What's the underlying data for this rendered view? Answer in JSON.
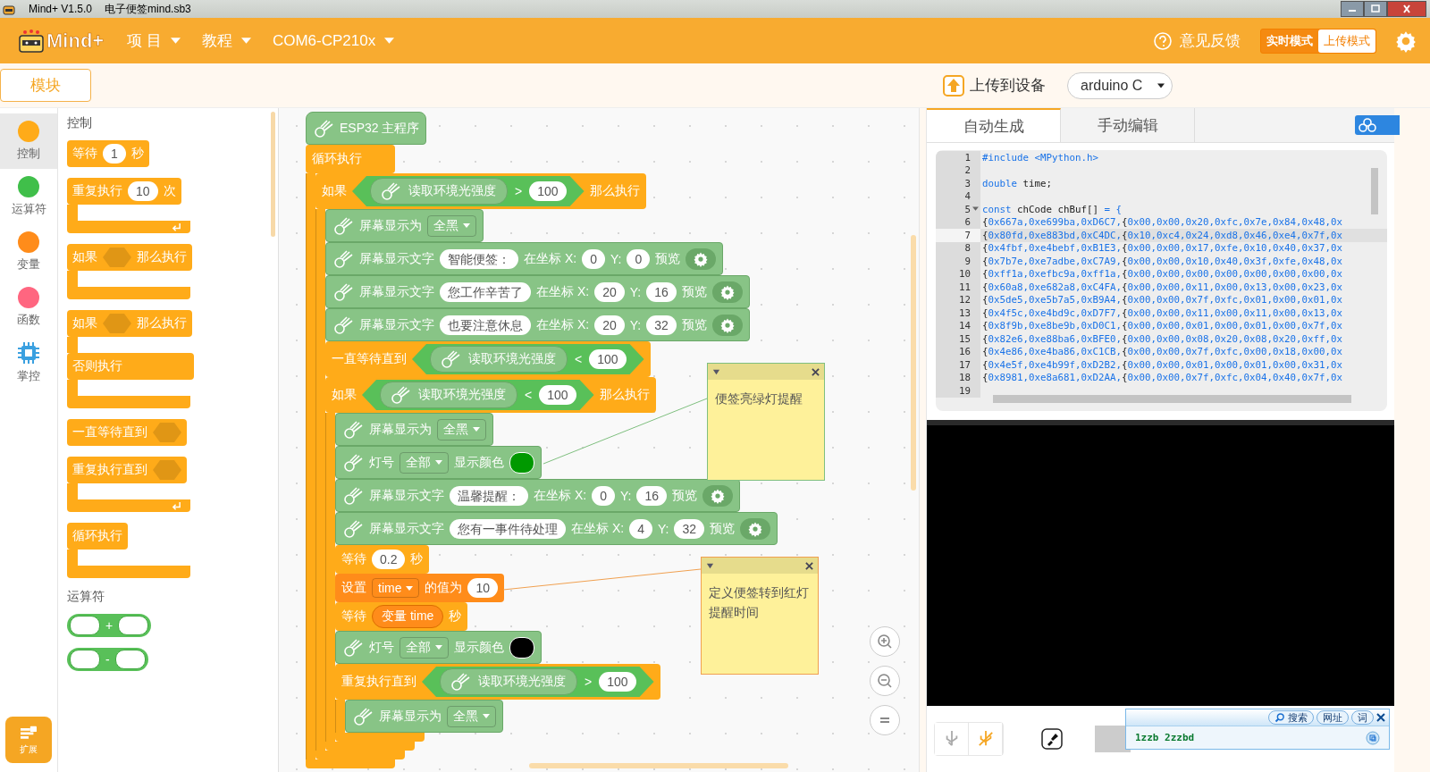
{
  "window": {
    "title": "Mind+ V1.5.0",
    "file": "电子便签mind.sb3"
  },
  "header": {
    "logo": "Mind+",
    "menus": [
      {
        "label": "项 目"
      },
      {
        "label": "教程"
      },
      {
        "label": "COM6-CP210x"
      }
    ],
    "feedback": "意见反馈",
    "modes": [
      {
        "label": "实时模式",
        "selected": false
      },
      {
        "label": "上传模式",
        "selected": true
      }
    ]
  },
  "toolbar": {
    "blocks_tab": "模块",
    "upload_button": "上传到设备",
    "board_select": "arduino C"
  },
  "categories": [
    {
      "label": "控制",
      "kind": "dot",
      "color": "#ffab19",
      "selected": true
    },
    {
      "label": "运算符",
      "kind": "dot",
      "color": "#40bf4a",
      "selected": false
    },
    {
      "label": "变量",
      "kind": "dot",
      "color": "#ff8c1a",
      "selected": false
    },
    {
      "label": "函数",
      "kind": "dot",
      "color": "#ff6680",
      "selected": false
    },
    {
      "label": "掌控",
      "kind": "chip",
      "color": "#3aa0e0",
      "selected": false
    }
  ],
  "extensions_button": "扩展",
  "palette": [
    {
      "title": "控制",
      "blocks": [
        {
          "kind": "stack",
          "color": "#ffab19",
          "parts": [
            {
              "kind": "text",
              "text": "等待"
            },
            {
              "kind": "field",
              "text": "1"
            },
            {
              "kind": "text",
              "text": "秒"
            }
          ]
        },
        {
          "kind": "loop",
          "color": "#ffab19",
          "parts": [
            {
              "kind": "text",
              "text": "重复执行"
            },
            {
              "kind": "field",
              "text": "10"
            },
            {
              "kind": "text",
              "text": "次"
            }
          ]
        },
        {
          "kind": "c",
          "color": "#ffab19",
          "parts": [
            {
              "kind": "text",
              "text": "如果"
            },
            {
              "kind": "slot"
            },
            {
              "kind": "text",
              "text": "那么执行"
            }
          ]
        },
        {
          "kind": "c_else",
          "color": "#ffab19",
          "parts": [
            {
              "kind": "text",
              "text": "如果"
            },
            {
              "kind": "slot"
            },
            {
              "kind": "text",
              "text": "那么执行"
            }
          ],
          "else_label": "否则执行"
        },
        {
          "kind": "stack",
          "color": "#ffab19",
          "parts": [
            {
              "kind": "text",
              "text": "一直等待直到"
            },
            {
              "kind": "slot"
            }
          ]
        },
        {
          "kind": "loop",
          "color": "#ffab19",
          "parts": [
            {
              "kind": "text",
              "text": "重复执行直到"
            },
            {
              "kind": "slot"
            }
          ]
        },
        {
          "kind": "c",
          "color": "#ffab19",
          "parts": [
            {
              "kind": "text",
              "text": "循环执行"
            }
          ]
        }
      ]
    },
    {
      "title": "运算符",
      "blocks": [
        {
          "kind": "reporter",
          "color": "#59c059",
          "parts": [
            {
              "kind": "round_slot"
            },
            {
              "kind": "text",
              "text": "+"
            },
            {
              "kind": "round_slot"
            }
          ]
        },
        {
          "kind": "reporter",
          "color": "#59c059",
          "parts": [
            {
              "kind": "round_slot"
            },
            {
              "kind": "text",
              "text": "-"
            },
            {
              "kind": "round_slot"
            }
          ]
        }
      ]
    }
  ],
  "workspace": {
    "script": [
      {
        "kind": "hat",
        "color": "#88c486",
        "parts": [
          {
            "kind": "icon"
          },
          {
            "kind": "text",
            "text": "ESP32 主程序"
          }
        ]
      },
      {
        "kind": "c",
        "color": "#ffab19",
        "parts": [
          {
            "kind": "text",
            "text": "循环执行"
          }
        ],
        "children": [
          {
            "kind": "c",
            "color": "#ffab19",
            "parts": [
              {
                "kind": "text",
                "text": "如果"
              },
              {
                "kind": "condition",
                "parts": [
                  {
                    "kind": "reporter",
                    "text": "读取环境光强度"
                  },
                  {
                    "kind": "text",
                    "text": ">"
                  },
                  {
                    "kind": "field",
                    "text": "100"
                  }
                ]
              },
              {
                "kind": "text",
                "text": "那么执行"
              }
            ],
            "children": [
              {
                "kind": "stack",
                "color": "#88c486",
                "parts": [
                  {
                    "kind": "icon"
                  },
                  {
                    "kind": "text",
                    "text": "屏幕显示为"
                  },
                  {
                    "kind": "dropdown",
                    "text": "全黑"
                  }
                ]
              },
              {
                "kind": "stack",
                "color": "#88c486",
                "parts": [
                  {
                    "kind": "icon"
                  },
                  {
                    "kind": "text",
                    "text": "屏幕显示文字"
                  },
                  {
                    "kind": "field",
                    "text": "智能便签："
                  },
                  {
                    "kind": "text",
                    "text": "在坐标 X:"
                  },
                  {
                    "kind": "field",
                    "text": "0"
                  },
                  {
                    "kind": "text",
                    "text": "Y:"
                  },
                  {
                    "kind": "field",
                    "text": "0"
                  },
                  {
                    "kind": "text",
                    "text": "预览"
                  },
                  {
                    "kind": "gear"
                  }
                ]
              },
              {
                "kind": "stack",
                "color": "#88c486",
                "parts": [
                  {
                    "kind": "icon"
                  },
                  {
                    "kind": "text",
                    "text": "屏幕显示文字"
                  },
                  {
                    "kind": "field",
                    "text": "您工作辛苦了"
                  },
                  {
                    "kind": "text",
                    "text": "在坐标 X:"
                  },
                  {
                    "kind": "field",
                    "text": "20"
                  },
                  {
                    "kind": "text",
                    "text": "Y:"
                  },
                  {
                    "kind": "field",
                    "text": "16"
                  },
                  {
                    "kind": "text",
                    "text": "预览"
                  },
                  {
                    "kind": "gear"
                  }
                ]
              },
              {
                "kind": "stack",
                "color": "#88c486",
                "parts": [
                  {
                    "kind": "icon"
                  },
                  {
                    "kind": "text",
                    "text": "屏幕显示文字"
                  },
                  {
                    "kind": "field",
                    "text": "也要注意休息"
                  },
                  {
                    "kind": "text",
                    "text": "在坐标 X:"
                  },
                  {
                    "kind": "field",
                    "text": "20"
                  },
                  {
                    "kind": "text",
                    "text": "Y:"
                  },
                  {
                    "kind": "field",
                    "text": "32"
                  },
                  {
                    "kind": "text",
                    "text": "预览"
                  },
                  {
                    "kind": "gear"
                  }
                ]
              },
              {
                "kind": "stack",
                "color": "#ffab19",
                "parts": [
                  {
                    "kind": "text",
                    "text": "一直等待直到"
                  },
                  {
                    "kind": "condition",
                    "parts": [
                      {
                        "kind": "reporter",
                        "text": "读取环境光强度"
                      },
                      {
                        "kind": "text",
                        "text": "<"
                      },
                      {
                        "kind": "field",
                        "text": "100"
                      }
                    ]
                  }
                ]
              },
              {
                "kind": "c",
                "color": "#ffab19",
                "parts": [
                  {
                    "kind": "text",
                    "text": "如果"
                  },
                  {
                    "kind": "condition",
                    "parts": [
                      {
                        "kind": "reporter",
                        "text": "读取环境光强度"
                      },
                      {
                        "kind": "text",
                        "text": "<"
                      },
                      {
                        "kind": "field",
                        "text": "100"
                      }
                    ]
                  },
                  {
                    "kind": "text",
                    "text": "那么执行"
                  }
                ],
                "children": [
                  {
                    "kind": "stack",
                    "color": "#88c486",
                    "parts": [
                      {
                        "kind": "icon"
                      },
                      {
                        "kind": "text",
                        "text": "屏幕显示为"
                      },
                      {
                        "kind": "dropdown",
                        "text": "全黑"
                      }
                    ]
                  },
                  {
                    "kind": "stack",
                    "color": "#88c486",
                    "parts": [
                      {
                        "kind": "icon"
                      },
                      {
                        "kind": "text",
                        "text": "灯号"
                      },
                      {
                        "kind": "dropdown",
                        "text": "全部"
                      },
                      {
                        "kind": "text",
                        "text": "显示颜色"
                      },
                      {
                        "kind": "swatch",
                        "color": "#009900"
                      }
                    ]
                  },
                  {
                    "kind": "stack",
                    "color": "#88c486",
                    "parts": [
                      {
                        "kind": "icon"
                      },
                      {
                        "kind": "text",
                        "text": "屏幕显示文字"
                      },
                      {
                        "kind": "field",
                        "text": "温馨提醒："
                      },
                      {
                        "kind": "text",
                        "text": "在坐标 X:"
                      },
                      {
                        "kind": "field",
                        "text": "0"
                      },
                      {
                        "kind": "text",
                        "text": "Y:"
                      },
                      {
                        "kind": "field",
                        "text": "16"
                      },
                      {
                        "kind": "text",
                        "text": "预览"
                      },
                      {
                        "kind": "gear"
                      }
                    ]
                  },
                  {
                    "kind": "stack",
                    "color": "#88c486",
                    "parts": [
                      {
                        "kind": "icon"
                      },
                      {
                        "kind": "text",
                        "text": "屏幕显示文字"
                      },
                      {
                        "kind": "field",
                        "text": "您有一事件待处理"
                      },
                      {
                        "kind": "text",
                        "text": "在坐标 X:"
                      },
                      {
                        "kind": "field",
                        "text": "4"
                      },
                      {
                        "kind": "text",
                        "text": "Y:"
                      },
                      {
                        "kind": "field",
                        "text": "32"
                      },
                      {
                        "kind": "text",
                        "text": "预览"
                      },
                      {
                        "kind": "gear"
                      }
                    ]
                  },
                  {
                    "kind": "stack",
                    "color": "#ffab19",
                    "parts": [
                      {
                        "kind": "text",
                        "text": "等待"
                      },
                      {
                        "kind": "field",
                        "text": "0.2"
                      },
                      {
                        "kind": "text",
                        "text": "秒"
                      }
                    ]
                  },
                  {
                    "kind": "stack",
                    "color": "#ff8c1a",
                    "parts": [
                      {
                        "kind": "text",
                        "text": "设置"
                      },
                      {
                        "kind": "dropdown",
                        "text": "time"
                      },
                      {
                        "kind": "text",
                        "text": "的值为"
                      },
                      {
                        "kind": "field",
                        "text": "10"
                      }
                    ]
                  },
                  {
                    "kind": "stack",
                    "color": "#ffab19",
                    "parts": [
                      {
                        "kind": "text",
                        "text": "等待"
                      },
                      {
                        "kind": "var",
                        "text": "变量 time"
                      },
                      {
                        "kind": "text",
                        "text": "秒"
                      }
                    ]
                  },
                  {
                    "kind": "stack",
                    "color": "#88c486",
                    "parts": [
                      {
                        "kind": "icon"
                      },
                      {
                        "kind": "text",
                        "text": "灯号"
                      },
                      {
                        "kind": "dropdown",
                        "text": "全部"
                      },
                      {
                        "kind": "text",
                        "text": "显示颜色"
                      },
                      {
                        "kind": "swatch",
                        "color": "#000000"
                      }
                    ]
                  },
                  {
                    "kind": "c",
                    "color": "#ffab19",
                    "parts": [
                      {
                        "kind": "text",
                        "text": "重复执行直到"
                      },
                      {
                        "kind": "condition",
                        "parts": [
                          {
                            "kind": "reporter",
                            "text": "读取环境光强度"
                          },
                          {
                            "kind": "text",
                            "text": ">"
                          },
                          {
                            "kind": "field",
                            "text": "100"
                          }
                        ]
                      }
                    ],
                    "children": [
                      {
                        "kind": "stack",
                        "color": "#88c486",
                        "parts": [
                          {
                            "kind": "icon"
                          },
                          {
                            "kind": "text",
                            "text": "屏幕显示为"
                          },
                          {
                            "kind": "dropdown",
                            "text": "全黑"
                          }
                        ]
                      }
                    ]
                  }
                ]
              }
            ]
          }
        ]
      }
    ],
    "comments": [
      {
        "text": "便签亮绿灯提醒",
        "color": "#7fbf7f"
      },
      {
        "text": "定义便签转到红灯提醒时间",
        "color": "#f0a050"
      }
    ]
  },
  "code_tabs": [
    {
      "label": "自动生成",
      "selected": true
    },
    {
      "label": "手动编辑",
      "selected": false
    }
  ],
  "editor": {
    "lines": [
      {
        "number": "1",
        "fold": false,
        "current": false,
        "segments": [
          {
            "kind": "keyword",
            "text": "#include <MPython.h>"
          }
        ]
      },
      {
        "number": "2",
        "fold": false,
        "current": false
      },
      {
        "number": "3",
        "fold": false,
        "current": false,
        "segments": [
          {
            "kind": "keyword",
            "text": "double"
          },
          {
            "kind": "plain",
            "text": " time;"
          }
        ]
      },
      {
        "number": "4",
        "fold": false,
        "current": false
      },
      {
        "number": "5",
        "fold": true,
        "current": false,
        "segments": [
          {
            "kind": "keyword",
            "text": "const"
          },
          {
            "kind": "plain",
            "text": " chCode chBuf[] "
          },
          {
            "kind": "keyword",
            "text": "= {"
          }
        ]
      },
      {
        "number": "6",
        "fold": false,
        "current": false,
        "segments": [
          {
            "kind": "plain",
            "text": "{"
          },
          {
            "kind": "keyword",
            "text": "0x667a,0xe699ba,0xD6C7,"
          },
          {
            "kind": "plain",
            "text": "{"
          },
          {
            "kind": "keyword",
            "text": "0x00,0x00,0x20,0xfc,0x7e,0x84,0x48,0x"
          }
        ]
      },
      {
        "number": "7",
        "fold": false,
        "current": true,
        "segments": [
          {
            "kind": "plain",
            "text": "{"
          },
          {
            "kind": "keyword",
            "text": "0x80fd,0xe883bd,0xC4DC,"
          },
          {
            "kind": "plain",
            "text": "{"
          },
          {
            "kind": "keyword",
            "text": "0x10,0xc4,0x24,0xd8,0x46,0xe4,0x7f,0x"
          }
        ]
      },
      {
        "number": "8",
        "fold": false,
        "current": false,
        "segments": [
          {
            "kind": "plain",
            "text": "{"
          },
          {
            "kind": "keyword",
            "text": "0x4fbf,0xe4bebf,0xB1E3,"
          },
          {
            "kind": "plain",
            "text": "{"
          },
          {
            "kind": "keyword",
            "text": "0x00,0x00,0x17,0xfe,0x10,0x40,0x37,0x"
          }
        ]
      },
      {
        "number": "9",
        "fold": false,
        "current": false,
        "segments": [
          {
            "kind": "plain",
            "text": "{"
          },
          {
            "kind": "keyword",
            "text": "0x7b7e,0xe7adbe,0xC7A9,"
          },
          {
            "kind": "plain",
            "text": "{"
          },
          {
            "kind": "keyword",
            "text": "0x00,0x00,0x10,0x40,0x3f,0xfe,0x48,0x"
          }
        ]
      },
      {
        "number": "10",
        "fold": false,
        "current": false,
        "segments": [
          {
            "kind": "plain",
            "text": "{"
          },
          {
            "kind": "keyword",
            "text": "0xff1a,0xefbc9a,0xff1a,"
          },
          {
            "kind": "plain",
            "text": "{"
          },
          {
            "kind": "keyword",
            "text": "0x00,0x00,0x00,0x00,0x00,0x00,0x00,0x"
          }
        ]
      },
      {
        "number": "11",
        "fold": false,
        "current": false,
        "segments": [
          {
            "kind": "plain",
            "text": "{"
          },
          {
            "kind": "keyword",
            "text": "0x60a8,0xe682a8,0xC4FA,"
          },
          {
            "kind": "plain",
            "text": "{"
          },
          {
            "kind": "keyword",
            "text": "0x00,0x00,0x11,0x00,0x13,0x00,0x23,0x"
          }
        ]
      },
      {
        "number": "12",
        "fold": false,
        "current": false,
        "segments": [
          {
            "kind": "plain",
            "text": "{"
          },
          {
            "kind": "keyword",
            "text": "0x5de5,0xe5b7a5,0xB9A4,"
          },
          {
            "kind": "plain",
            "text": "{"
          },
          {
            "kind": "keyword",
            "text": "0x00,0x00,0x7f,0xfc,0x01,0x00,0x01,0x"
          }
        ]
      },
      {
        "number": "13",
        "fold": false,
        "current": false,
        "segments": [
          {
            "kind": "plain",
            "text": "{"
          },
          {
            "kind": "keyword",
            "text": "0x4f5c,0xe4bd9c,0xD7F7,"
          },
          {
            "kind": "plain",
            "text": "{"
          },
          {
            "kind": "keyword",
            "text": "0x00,0x00,0x11,0x00,0x11,0x00,0x13,0x"
          }
        ]
      },
      {
        "number": "14",
        "fold": false,
        "current": false,
        "segments": [
          {
            "kind": "plain",
            "text": "{"
          },
          {
            "kind": "keyword",
            "text": "0x8f9b,0xe8be9b,0xD0C1,"
          },
          {
            "kind": "plain",
            "text": "{"
          },
          {
            "kind": "keyword",
            "text": "0x00,0x00,0x01,0x00,0x01,0x00,0x7f,0x"
          }
        ]
      },
      {
        "number": "15",
        "fold": false,
        "current": false,
        "segments": [
          {
            "kind": "plain",
            "text": "{"
          },
          {
            "kind": "keyword",
            "text": "0x82e6,0xe88ba6,0xBFE0,"
          },
          {
            "kind": "plain",
            "text": "{"
          },
          {
            "kind": "keyword",
            "text": "0x00,0x00,0x08,0x20,0x08,0x20,0xff,0x"
          }
        ]
      },
      {
        "number": "16",
        "fold": false,
        "current": false,
        "segments": [
          {
            "kind": "plain",
            "text": "{"
          },
          {
            "kind": "keyword",
            "text": "0x4e86,0xe4ba86,0xC1CB,"
          },
          {
            "kind": "plain",
            "text": "{"
          },
          {
            "kind": "keyword",
            "text": "0x00,0x00,0x7f,0xfc,0x00,0x18,0x00,0x"
          }
        ]
      },
      {
        "number": "17",
        "fold": false,
        "current": false,
        "segments": [
          {
            "kind": "plain",
            "text": "{"
          },
          {
            "kind": "keyword",
            "text": "0x4e5f,0xe4b99f,0xD2B2,"
          },
          {
            "kind": "plain",
            "text": "{"
          },
          {
            "kind": "keyword",
            "text": "0x00,0x00,0x01,0x00,0x01,0x00,0x31,0x"
          }
        ]
      },
      {
        "number": "18",
        "fold": false,
        "current": false,
        "segments": [
          {
            "kind": "plain",
            "text": "{"
          },
          {
            "kind": "keyword",
            "text": "0x8981,0xe8a681,0xD2AA,"
          },
          {
            "kind": "plain",
            "text": "{"
          },
          {
            "kind": "keyword",
            "text": "0x00,0x00,0x7f,0xfc,0x04,0x40,0x7f,0x"
          }
        ]
      },
      {
        "number": "19",
        "fold": false,
        "current": false
      }
    ]
  },
  "dictionary_popup": {
    "search_button": "搜索",
    "url_button": "网址",
    "word_button": "词",
    "text": "1zzb 2zzbd"
  }
}
